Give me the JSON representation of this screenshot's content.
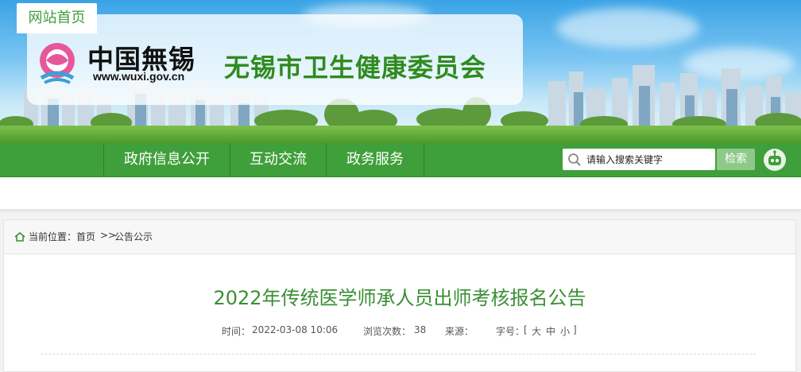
{
  "header": {
    "logo_text": "中国無锡",
    "logo_url": "www.wuxi.gov.cn",
    "site_title": "无锡市卫生健康委员会"
  },
  "nav": {
    "items": [
      {
        "label": "网站首页",
        "active": true
      },
      {
        "label": "政府信息公开",
        "active": false
      },
      {
        "label": "互动交流",
        "active": false
      },
      {
        "label": "政务服务",
        "active": false
      }
    ]
  },
  "search": {
    "placeholder": "请输入搜索关键字",
    "button_label": "检索"
  },
  "breadcrumb": {
    "prefix": "当前位置：",
    "home": "首页",
    "separator": ">>",
    "current": "公告公示"
  },
  "article": {
    "title": "2022年传统医学师承人员出师考核报名公告",
    "time_label": "时间：",
    "time_value": "2022-03-08 10:06",
    "views_label": "浏览次数：",
    "views_value": "38",
    "source_label": "来源：",
    "source_value": "",
    "fontsize_label": "字号：",
    "fontsize_open": "[",
    "fontsize_large": "大",
    "fontsize_medium": "中",
    "fontsize_small": "小",
    "fontsize_close": "]"
  },
  "colors": {
    "brand_green": "#3f9f3a",
    "title_green": "#2f8b1f",
    "sky": "#3aa3e6"
  }
}
